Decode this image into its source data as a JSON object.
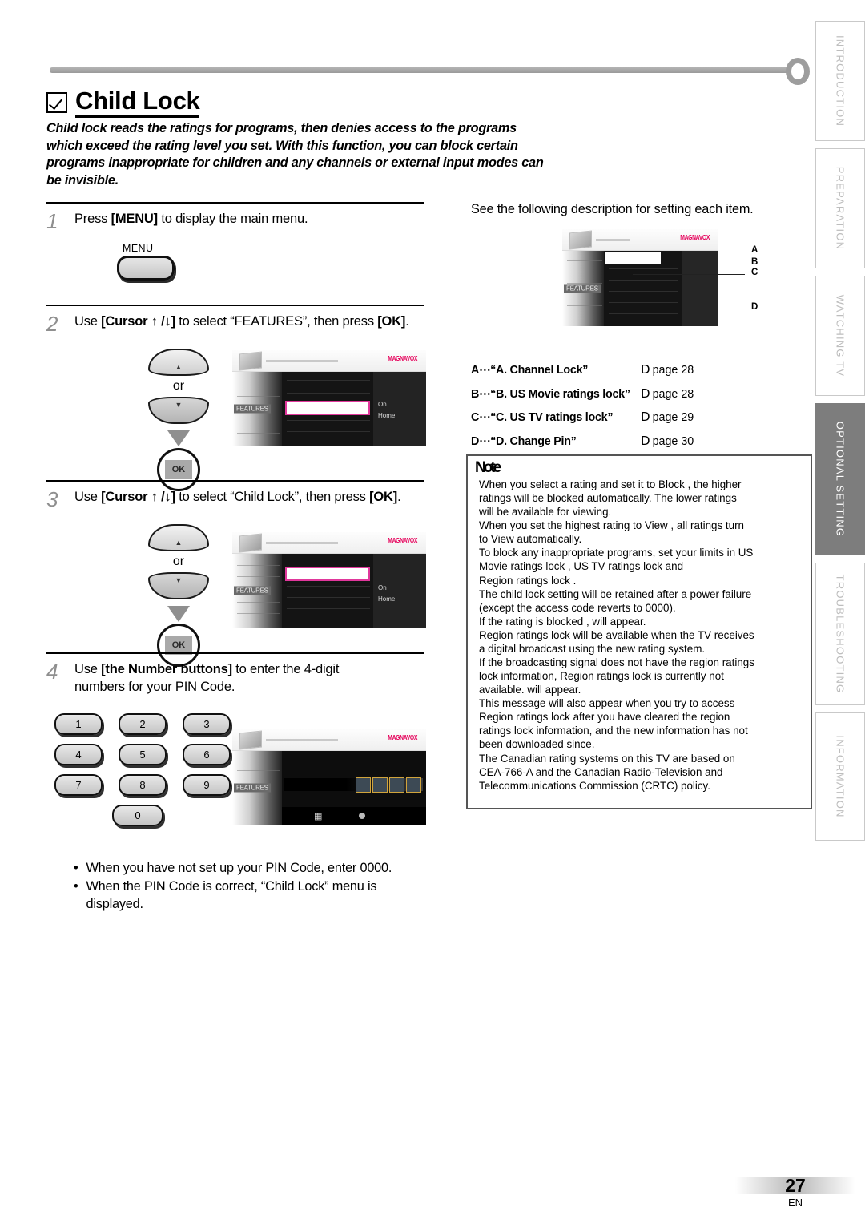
{
  "heading": {
    "checkbox_icon": "checked-box-icon",
    "title": "Child Lock",
    "lede": "Child lock reads the ratings for programs, then denies access to the programs which exceed the rating level you set. With this function, you can block certain programs inappropriate for children and any channels or external input modes can be invisible."
  },
  "steps": [
    {
      "number": "1",
      "text_before": "Press ",
      "text_bold": "[MENU]",
      "text_after": " to display the main menu.",
      "menu_button_label": "MENU"
    },
    {
      "number": "2",
      "text_before": "Use ",
      "text_bold": "[Cursor ↑ /↓]",
      "text_after": " to select “FEATURES”, then press ",
      "text_bold2": "[OK]",
      "text_end": ".",
      "or_label": "or",
      "ok_label": "OK"
    },
    {
      "number": "3",
      "text_before": "Use ",
      "text_bold": "[Cursor ↑ /↓]",
      "text_after": " to select “Child Lock”, then press ",
      "text_bold2": "[OK]",
      "text_end": ".",
      "or_label": "or",
      "ok_label": "OK"
    },
    {
      "number": "4",
      "text_before": "Use ",
      "text_bold": "[the Number buttons]",
      "text_after": " to enter the 4-digit numbers for your PIN Code."
    }
  ],
  "numpad": {
    "rows": [
      [
        "1",
        "2",
        "3"
      ],
      [
        "4",
        "5",
        "6"
      ],
      [
        "7",
        "8",
        "9"
      ]
    ],
    "last": [
      "0"
    ]
  },
  "osd": {
    "brand": "MAGNAVOX",
    "menu_tab": "FEATURES",
    "right_items": [
      "On",
      "Home"
    ]
  },
  "bullets": [
    "When you have not set up your PIN Code, enter 0000.",
    "When the PIN Code is correct, “Child Lock” menu is displayed."
  ],
  "right": {
    "intro": "See the following description for setting each item.",
    "callouts": [
      "A",
      "B",
      "C",
      "D"
    ],
    "items": [
      {
        "key": "A⋯“A. Channel Lock”",
        "page": "page 28",
        "marker": "D"
      },
      {
        "key": "B⋯“B. US Movie ratings lock”",
        "page": "page 28",
        "marker": "D"
      },
      {
        "key": "C⋯“C. US TV ratings lock”",
        "page": "page 29",
        "marker": "D"
      },
      {
        "key": "D⋯“D. Change Pin”",
        "page": "page 30",
        "marker": "D"
      }
    ]
  },
  "note": {
    "title": "Note",
    "lines": [
      "When you select a rating and set it to  Block , the higher",
      "ratings will be blocked automatically. The lower ratings",
      "will be available for viewing.",
      "When you set the highest rating to  View , all ratings turn",
      "to  View  automatically.",
      "To block any inappropriate programs, set your limits in  US",
      "Movie ratings lock ,  US TV ratings lock  and",
      " Region ratings lock .",
      "The child lock setting will be retained after a power failure",
      "(except the access code reverts to 0000).",
      "If the rating is blocked ,  will appear.",
      " Region ratings lock  will be available when the TV receives",
      "a digital broadcast using the new rating system.",
      "If the broadcasting signal does not have the region ratings",
      "lock information,  Region ratings lock is currently not",
      "available.  will appear.",
      "This message will also appear when you try to access",
      " Region ratings lock  after you have cleared the region",
      "ratings lock information, and the new information has not",
      "been downloaded since.",
      "The Canadian rating systems on this TV are based on",
      "CEA-766-A and the Canadian Radio-Television and",
      "Telecommunications Commission (CRTC) policy."
    ]
  },
  "sidebar_tabs": [
    {
      "label": "INTRODUCTION",
      "active": false
    },
    {
      "label": "PREPARATION",
      "active": false
    },
    {
      "label": "WATCHING  TV",
      "active": false
    },
    {
      "label": "OPTIONAL  SETTING",
      "active": true
    },
    {
      "label": "TROUBLESHOOTING",
      "active": false
    },
    {
      "label": "INFORMATION",
      "active": false
    }
  ],
  "footer": {
    "page_number": "27",
    "lang": "EN"
  },
  "colors": {
    "accent": "#e0379b",
    "brand": "#e6005a",
    "tab_active": "#7d7d7d"
  }
}
